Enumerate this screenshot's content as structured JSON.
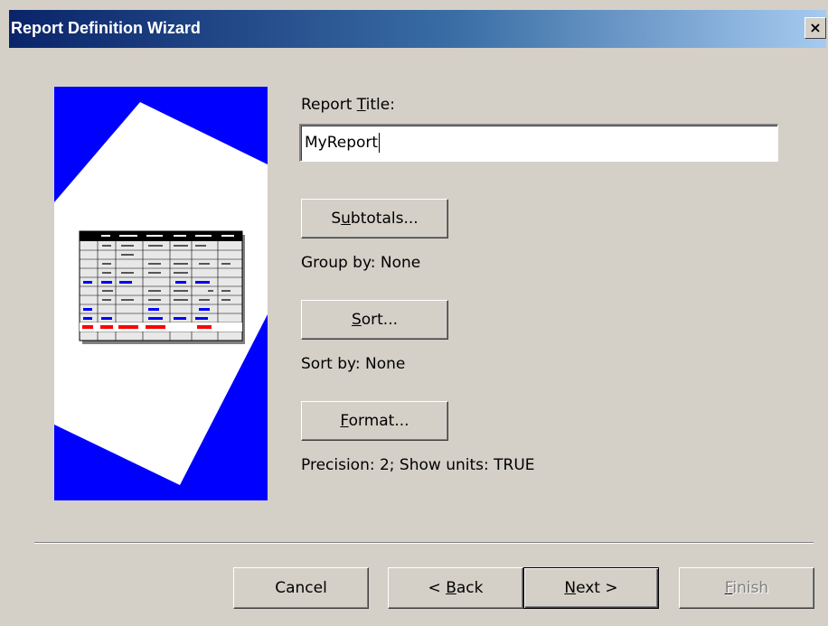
{
  "window": {
    "title": "Report Definition Wizard",
    "close_glyph": "×"
  },
  "report_title": {
    "label_pre": "Report ",
    "label_accel": "T",
    "label_post": "itle:",
    "value": "MyReport"
  },
  "subtotals": {
    "button_pre": "S",
    "button_accel": "u",
    "button_post": "btotals...",
    "status": "Group by: None"
  },
  "sort": {
    "button_pre": "",
    "button_accel": "S",
    "button_post": "ort...",
    "status": "Sort by: None"
  },
  "format": {
    "button_pre": "",
    "button_accel": "F",
    "button_post": "ormat...",
    "status": "Precision: 2;  Show units: TRUE"
  },
  "footer": {
    "cancel_label": "Cancel",
    "back_pre": "< ",
    "back_accel": "B",
    "back_post": "ack",
    "next_accel": "N",
    "next_post": "ext >",
    "finish_accel": "F",
    "finish_post": "inish"
  },
  "colors": {
    "dialog_bg": "#d4d0c8",
    "titlebar_start": "#0a246a",
    "titlebar_end": "#a6caf0",
    "image_bg": "#0000ff"
  }
}
